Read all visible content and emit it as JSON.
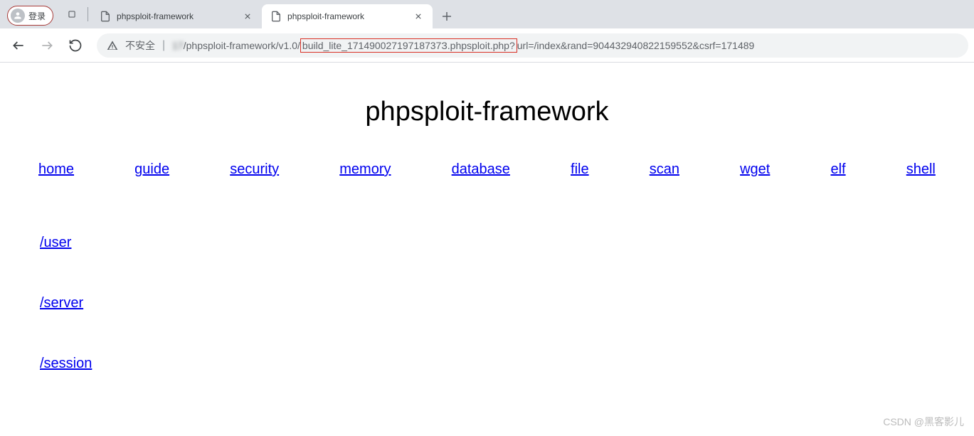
{
  "chrome": {
    "profile_label": "登录",
    "tabs": [
      {
        "title": "phpsploit-framework",
        "active": false
      },
      {
        "title": "phpsploit-framework",
        "active": true
      }
    ],
    "insecure_label": "不安全",
    "url": {
      "prefix_blurred": "17",
      "prefix": "/phpsploit-framework/v1.0/",
      "highlighted": "build_lite_17149002719718737З.phpsploit.php?",
      "suffix": "url=/index&rand=904432940822159552&csrf=171489"
    }
  },
  "page": {
    "title": "phpsploit-framework",
    "nav": [
      "home",
      "guide",
      "security",
      "memory",
      "database",
      "file",
      "scan",
      "wget",
      "elf",
      "shell"
    ],
    "list": [
      "/user",
      "/server",
      "/session"
    ]
  },
  "watermark": "CSDN @黑客影儿"
}
